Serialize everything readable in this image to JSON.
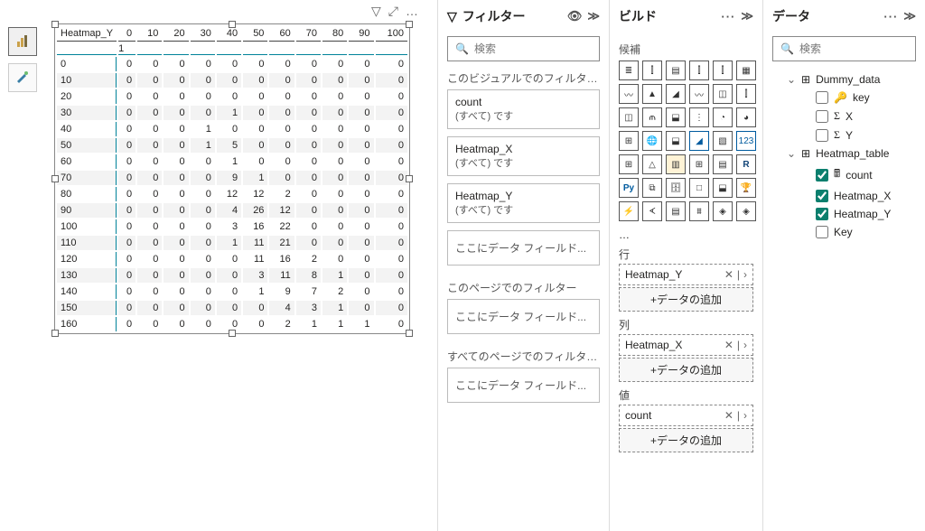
{
  "tooltips": {
    "bar_tool": "bar-chart-visual",
    "brush_tool": "format-visual"
  },
  "matrix_icons": {
    "filter": "▽",
    "focus": "⤢",
    "more": "…"
  },
  "matrix": {
    "row_label": "Heatmap_Y",
    "columns": [
      "0",
      "10",
      "20",
      "30",
      "40",
      "50",
      "60",
      "70",
      "80",
      "90",
      "100"
    ],
    "sub_col": "1",
    "rows": [
      {
        "h": "0",
        "c": [
          "0",
          "0",
          "0",
          "0",
          "0",
          "0",
          "0",
          "0",
          "0",
          "0",
          "0"
        ]
      },
      {
        "h": "10",
        "c": [
          "0",
          "0",
          "0",
          "0",
          "0",
          "0",
          "0",
          "0",
          "0",
          "0",
          "0"
        ]
      },
      {
        "h": "20",
        "c": [
          "0",
          "0",
          "0",
          "0",
          "0",
          "0",
          "0",
          "0",
          "0",
          "0",
          "0"
        ]
      },
      {
        "h": "30",
        "c": [
          "0",
          "0",
          "0",
          "0",
          "1",
          "0",
          "0",
          "0",
          "0",
          "0",
          "0"
        ]
      },
      {
        "h": "40",
        "c": [
          "0",
          "0",
          "0",
          "1",
          "0",
          "0",
          "0",
          "0",
          "0",
          "0",
          "0"
        ]
      },
      {
        "h": "50",
        "c": [
          "0",
          "0",
          "0",
          "1",
          "5",
          "0",
          "0",
          "0",
          "0",
          "0",
          "0"
        ]
      },
      {
        "h": "60",
        "c": [
          "0",
          "0",
          "0",
          "0",
          "1",
          "0",
          "0",
          "0",
          "0",
          "0",
          "0"
        ]
      },
      {
        "h": "70",
        "c": [
          "0",
          "0",
          "0",
          "0",
          "9",
          "1",
          "0",
          "0",
          "0",
          "0",
          "0"
        ]
      },
      {
        "h": "80",
        "c": [
          "0",
          "0",
          "0",
          "0",
          "12",
          "12",
          "2",
          "0",
          "0",
          "0",
          "0"
        ]
      },
      {
        "h": "90",
        "c": [
          "0",
          "0",
          "0",
          "0",
          "4",
          "26",
          "12",
          "0",
          "0",
          "0",
          "0"
        ]
      },
      {
        "h": "100",
        "c": [
          "0",
          "0",
          "0",
          "0",
          "3",
          "16",
          "22",
          "0",
          "0",
          "0",
          "0"
        ]
      },
      {
        "h": "110",
        "c": [
          "0",
          "0",
          "0",
          "0",
          "1",
          "11",
          "21",
          "0",
          "0",
          "0",
          "0"
        ]
      },
      {
        "h": "120",
        "c": [
          "0",
          "0",
          "0",
          "0",
          "0",
          "11",
          "16",
          "2",
          "0",
          "0",
          "0"
        ]
      },
      {
        "h": "130",
        "c": [
          "0",
          "0",
          "0",
          "0",
          "0",
          "3",
          "11",
          "8",
          "1",
          "0",
          "0"
        ]
      },
      {
        "h": "140",
        "c": [
          "0",
          "0",
          "0",
          "0",
          "0",
          "1",
          "9",
          "7",
          "2",
          "0",
          "0"
        ]
      },
      {
        "h": "150",
        "c": [
          "0",
          "0",
          "0",
          "0",
          "0",
          "0",
          "4",
          "3",
          "1",
          "0",
          "0"
        ]
      },
      {
        "h": "160",
        "c": [
          "0",
          "0",
          "0",
          "0",
          "0",
          "0",
          "2",
          "1",
          "1",
          "1",
          "0"
        ]
      }
    ]
  },
  "filters": {
    "title": "フィルター",
    "search_ph": "検索",
    "on_visual": "このビジュアルでのフィルター…",
    "cards": [
      {
        "title": "count",
        "desc": "(すべて) です"
      },
      {
        "title": "Heatmap_X",
        "desc": "(すべて) です"
      },
      {
        "title": "Heatmap_Y",
        "desc": "(すべて) です"
      }
    ],
    "drop_visual": "ここにデータ フィールド...",
    "on_page": "このページでのフィルター",
    "drop_page": "ここにデータ フィールド...",
    "on_all": "すべてのページでのフィルター…",
    "drop_all": "ここにデータ フィールド..."
  },
  "build": {
    "title": "ビルド",
    "candidates": "候補",
    "rows": "行",
    "rows_field": "Heatmap_Y",
    "cols": "列",
    "cols_field": "Heatmap_X",
    "values": "値",
    "values_field": "count",
    "add": "+データの追加",
    "more": "…"
  },
  "data": {
    "title": "データ",
    "search_ph": "検索",
    "table1": "Dummy_data",
    "t1_f1": "key",
    "t1_f2": "X",
    "t1_f3": "Y",
    "table2": "Heatmap_table",
    "t2_f1": "count",
    "t2_f2": "Heatmap_X",
    "t2_f3": "Heatmap_Y",
    "t2_f4": "Key"
  },
  "glyph": {
    "eye": "◉",
    "expand": "≫",
    "dots": "···"
  }
}
